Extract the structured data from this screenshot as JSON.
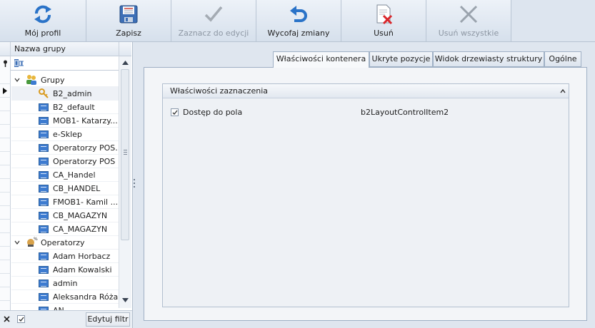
{
  "toolbar": {
    "buttons": [
      {
        "label": "Mój profil",
        "icon": "refresh-icon",
        "enabled": true
      },
      {
        "label": "Zapisz",
        "icon": "save-icon",
        "enabled": true
      },
      {
        "label": "Zaznacz do edycji",
        "icon": "checkmark-icon",
        "enabled": false
      },
      {
        "label": "Wycofaj zmiany",
        "icon": "undo-icon",
        "enabled": true
      },
      {
        "label": "Usuń",
        "icon": "delete-document-icon",
        "enabled": true
      },
      {
        "label": "Usuń wszystkie",
        "icon": "close-x-icon",
        "enabled": false
      }
    ]
  },
  "tree": {
    "column_header": "Nazwa grupy",
    "filter_text": "",
    "groups_label": "Grupy",
    "groups": [
      "B2_admin",
      "B2_default",
      "MOB1- Katarzy...",
      "e-Sklep",
      "Operatorzy POS...",
      "Operatorzy POS",
      "CA_Handel",
      "CB_HANDEL",
      "FMOB1- Kamil ...",
      "CB_MAGAZYN",
      "CA_MAGAZYN"
    ],
    "operators_label": "Operatorzy",
    "operators": [
      "Adam Horbacz",
      "Adam Kowalski",
      "admin",
      "Aleksandra Róża",
      "AN..."
    ],
    "selected": "B2_admin"
  },
  "bottom_bar": {
    "edit_filter_label": "Edytuj filtr"
  },
  "tabs": [
    {
      "label": "Właściwości kontenera",
      "active": true
    },
    {
      "label": "Ukryte pozycje",
      "active": false
    },
    {
      "label": "Widok drzewiasty struktury",
      "active": false
    },
    {
      "label": "Ogólne",
      "active": false
    }
  ],
  "selection_panel": {
    "title": "Właściwości zaznaczenia",
    "field_access_label": "Dostęp do pola",
    "field_access_checked": true,
    "item_name": "b2LayoutControlItem2"
  },
  "colors": {
    "accent_blue": "#3d7bd0",
    "delete_red": "#d9262b",
    "undo_blue": "#2a73c8",
    "disabled_gray": "#9aa3ad"
  }
}
